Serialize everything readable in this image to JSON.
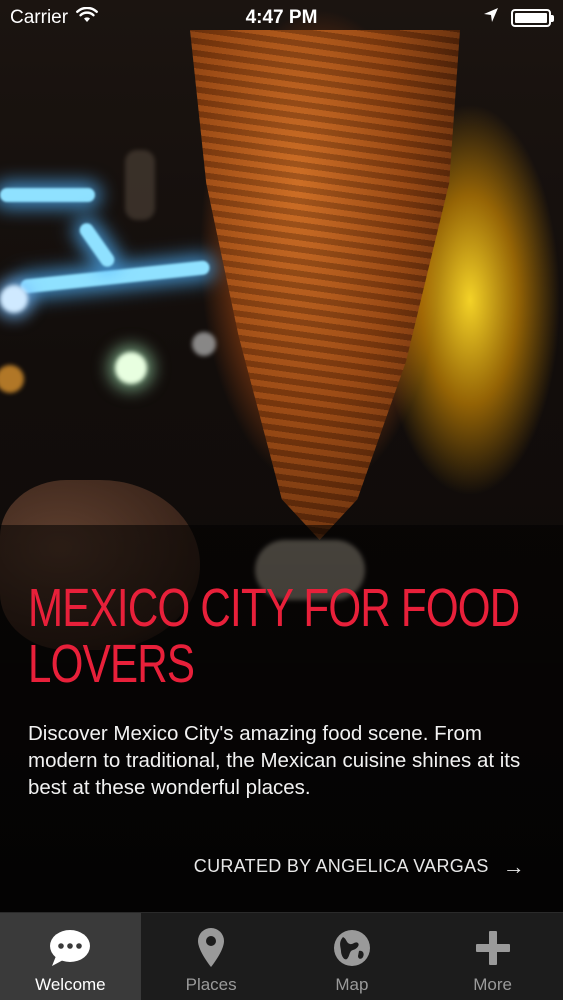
{
  "status_bar": {
    "carrier": "Carrier",
    "time": "4:47 PM"
  },
  "hero": {
    "title": "MEXICO CITY FOR FOOD LOVERS",
    "description": "Discover Mexico City's amazing food scene. From modern to traditional, the Mexican cuisine shines at its best at these wonderful places.",
    "curated_by": "CURATED BY ANGELICA VARGAS",
    "curated_arrow": "→"
  },
  "tabs": [
    {
      "label": "Welcome",
      "icon": "chat-bubble-icon",
      "active": true
    },
    {
      "label": "Places",
      "icon": "map-pin-icon",
      "active": false
    },
    {
      "label": "Map",
      "icon": "globe-icon",
      "active": false
    },
    {
      "label": "More",
      "icon": "plus-icon",
      "active": false
    }
  ],
  "colors": {
    "title_red": "#e8203a",
    "tab_bar_bg": "#1c1c1c",
    "tab_active_bg": "#3a3a3a"
  }
}
